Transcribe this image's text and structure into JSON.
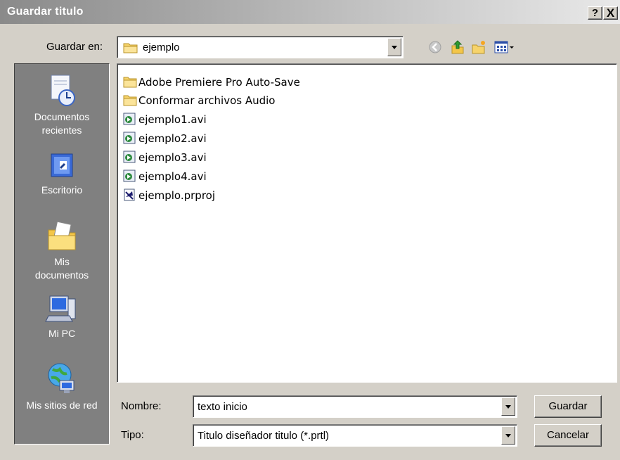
{
  "window": {
    "title": "Guardar titulo",
    "help_label": "?",
    "close_label": "X"
  },
  "toolbar": {
    "save_in_label": "Guardar en:",
    "current_folder": "ejemplo",
    "icons": [
      "back-icon",
      "up-folder-icon",
      "new-folder-icon",
      "view-menu-icon"
    ]
  },
  "places": [
    {
      "label": "Documentos recientes",
      "icon": "recent-documents-icon"
    },
    {
      "label": "Escritorio",
      "icon": "desktop-icon"
    },
    {
      "label": "Mis documentos",
      "icon": "my-documents-icon"
    },
    {
      "label": "Mi PC",
      "icon": "my-computer-icon"
    },
    {
      "label": "Mis sitios de red",
      "icon": "network-places-icon"
    }
  ],
  "files": [
    {
      "name": "Adobe Premiere Pro Auto-Save",
      "icon": "folder-icon"
    },
    {
      "name": "Conformar archivos Audio",
      "icon": "folder-icon"
    },
    {
      "name": "ejemplo1.avi",
      "icon": "avi-file-icon"
    },
    {
      "name": "ejemplo2.avi",
      "icon": "avi-file-icon"
    },
    {
      "name": "ejemplo3.avi",
      "icon": "avi-file-icon"
    },
    {
      "name": "ejemplo4.avi",
      "icon": "avi-file-icon"
    },
    {
      "name": "ejemplo.prproj",
      "icon": "premiere-project-icon"
    }
  ],
  "form": {
    "name_label": "Nombre:",
    "name_value": "texto inicio",
    "type_label": "Tipo:",
    "type_value": "Titulo diseñador titulo (*.prtl)"
  },
  "buttons": {
    "save": "Guardar",
    "cancel": "Cancelar"
  }
}
